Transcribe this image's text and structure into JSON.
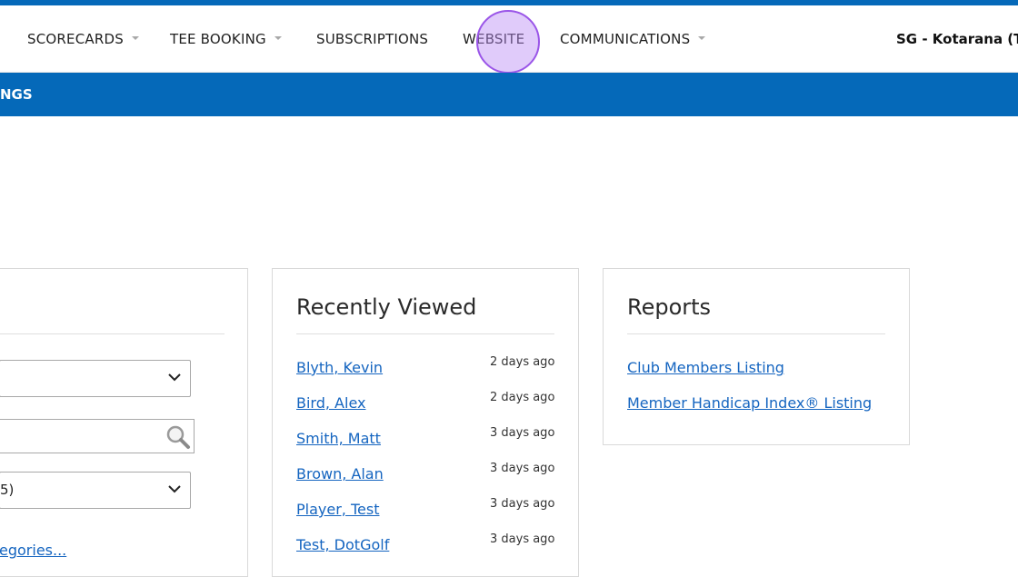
{
  "nav": {
    "items": [
      {
        "label": "SCORECARDS",
        "dropdown": true
      },
      {
        "label": "TEE BOOKING",
        "dropdown": true
      },
      {
        "label": "SUBSCRIPTIONS",
        "dropdown": false
      },
      {
        "label": "WEBSITE",
        "dropdown": false
      },
      {
        "label": "COMMUNICATIONS",
        "dropdown": true
      }
    ],
    "club_name": "SG - Kotarana (TE"
  },
  "subbar": {
    "label": "NGS"
  },
  "left_panel": {
    "select1_value": "",
    "search_value": "",
    "select2_value": "5)",
    "categories_link": "egories..."
  },
  "recently_viewed": {
    "title": "Recently Viewed",
    "items": [
      {
        "name": "Blyth, Kevin",
        "time": "2 days ago"
      },
      {
        "name": "Bird, Alex",
        "time": "2 days ago"
      },
      {
        "name": "Smith, Matt",
        "time": "3 days ago"
      },
      {
        "name": "Brown, Alan",
        "time": "3 days ago"
      },
      {
        "name": "Player, Test",
        "time": "3 days ago"
      },
      {
        "name": "Test, DotGolf",
        "time": "3 days ago"
      }
    ]
  },
  "reports": {
    "title": "Reports",
    "items": [
      {
        "label": "Club Members Listing"
      },
      {
        "label": "Member Handicap Index® Listing"
      }
    ]
  },
  "colors": {
    "brand": "#0569b9",
    "link": "#1565c0"
  }
}
